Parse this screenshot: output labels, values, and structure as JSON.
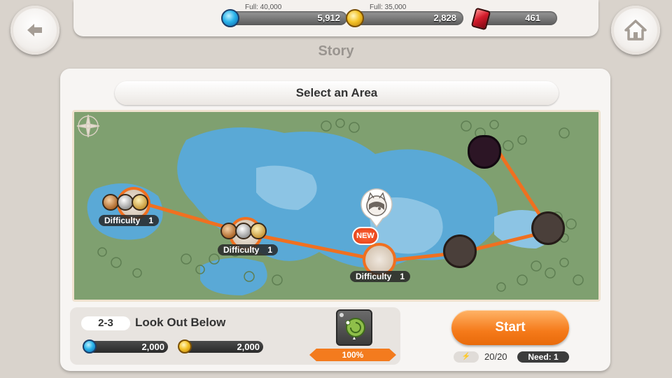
{
  "header": {
    "page_title": "Story",
    "resources": [
      {
        "icon": "blue-gem-icon",
        "cap_label": "Full: 40,000",
        "value": "5,912"
      },
      {
        "icon": "gold-coin-icon",
        "cap_label": "Full: 35,000",
        "value": "2,828"
      },
      {
        "icon": "red-crystal-icon",
        "cap_label": "",
        "value": "461"
      }
    ]
  },
  "area_select": {
    "title": "Select an Area"
  },
  "stages": [
    {
      "difficulty_label": "Difficulty",
      "difficulty_value": "1",
      "status": "cleared"
    },
    {
      "difficulty_label": "Difficulty",
      "difficulty_value": "1",
      "status": "cleared"
    },
    {
      "difficulty_label": "Difficulty",
      "difficulty_value": "1",
      "status": "new"
    },
    {
      "status": "locked"
    },
    {
      "status": "locked"
    },
    {
      "status": "boss"
    }
  ],
  "new_badge": "NEW",
  "stage_info": {
    "number": "2-3",
    "name": "Look Out Below",
    "rewards": [
      {
        "icon": "blue-gem-icon",
        "value": "2,000"
      },
      {
        "icon": "gold-coin-icon",
        "value": "2,000"
      }
    ],
    "item_drop_rate": "100%"
  },
  "start": {
    "label": "Start",
    "stamina_icon": "⚡",
    "stamina": "20/20",
    "need": "Need: 1"
  },
  "colors": {
    "accent": "#f57a1a",
    "path": "#f07020",
    "map_land": "#7ea16f",
    "map_water": "#5aa9d6"
  }
}
